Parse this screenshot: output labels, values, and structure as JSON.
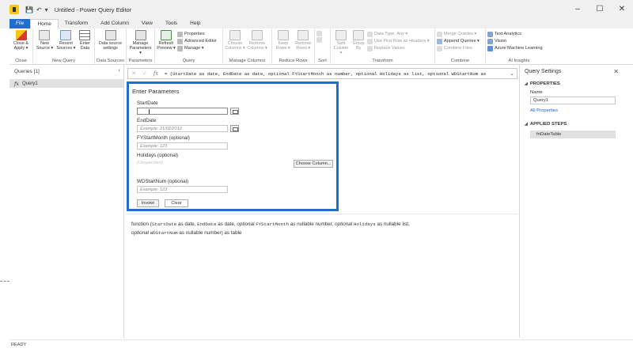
{
  "window": {
    "title": "Untitled - Power Query Editor",
    "controls": {
      "minimize": "–",
      "maximize": "☐",
      "close": "✕"
    }
  },
  "quick_access": [
    "💾",
    "↶",
    "▾"
  ],
  "tabs": [
    "File",
    "Home",
    "Transform",
    "Add Column",
    "View",
    "Tools",
    "Help"
  ],
  "ribbon": {
    "close": {
      "label": "Close",
      "close_apply": "Close & Apply ▾"
    },
    "new_query": {
      "label": "New Query",
      "new_source": "New Source ▾",
      "recent_sources": "Recent Sources ▾",
      "enter_data": "Enter Data"
    },
    "data_sources": {
      "label": "Data Sources",
      "settings": "Data source settings"
    },
    "parameters": {
      "label": "Parameters",
      "manage": "Manage Parameters ▾"
    },
    "query": {
      "label": "Query",
      "refresh": "Refresh Preview ▾",
      "properties": "Properties",
      "advanced_editor": "Advanced Editor",
      "manage": "Manage ▾"
    },
    "manage_columns": {
      "label": "Manage Columns",
      "choose": "Choose Columns ▾",
      "remove": "Remove Columns ▾"
    },
    "reduce_rows": {
      "label": "Reduce Rows",
      "keep": "Keep Rows ▾",
      "remove": "Remove Rows ▾"
    },
    "sort": {
      "label": "Sort"
    },
    "transform": {
      "label": "Transform",
      "split": "Split Column ▾",
      "group_by": "Group By",
      "data_type": "Data Type: Any ▾",
      "first_row": "Use First Row as Headers ▾",
      "replace": "Replace Values"
    },
    "combine": {
      "label": "Combine",
      "merge": "Merge Queries ▾",
      "append": "Append Queries ▾",
      "combine_files": "Combine Files"
    },
    "ai_insights": {
      "label": "AI Insights",
      "text_analytics": "Text Analytics",
      "vision": "Vision",
      "azure_ml": "Azure Machine Learning"
    }
  },
  "queries_pane": {
    "header": "Queries [1]",
    "collapse": "‹",
    "items": [
      {
        "icon": "fx",
        "name": "Query1"
      }
    ]
  },
  "formula_bar": {
    "cancel": "✕",
    "commit": "✓",
    "fx": "fx",
    "text": "= (StartDate as date, EndDate as date, optional FYStartMonth as number, optional Holidays as list, optional WDStartNum as",
    "expand": "⌄"
  },
  "enter_parameters": {
    "title": "Enter Parameters",
    "start_date": {
      "label": "StartDate",
      "value": ""
    },
    "end_date": {
      "label": "EndDate",
      "placeholder": "Example: 21/02/2012"
    },
    "fy_start_month": {
      "label": "FYStartMonth (optional)",
      "placeholder": "Example: 123"
    },
    "holidays": {
      "label": "Holidays (optional)",
      "value": "(Unspecified)",
      "choose_column": "Choose Column..."
    },
    "wd_start_num": {
      "label": "WDStartNum (optional)",
      "placeholder": "Example: 123"
    },
    "invoke": "Invoke",
    "clear": "Clear"
  },
  "function_description": {
    "p1": "function (",
    "p2": "StartDate",
    "p3": " as date, ",
    "p4": "EndDate",
    "p5": " as date, ",
    "p6": "optional",
    "p7": " ",
    "p8": "FYStartMonth",
    "p9": " as nullable number, ",
    "p10": "optional",
    "p11": " ",
    "p12": "Holidays",
    "p13": " as nullable list,",
    "p14": "optional",
    "p15": " ",
    "p16": "WDStartNum",
    "p17": " as nullable number) as table"
  },
  "query_settings": {
    "title": "Query Settings",
    "close": "✕",
    "properties_header": "PROPERTIES",
    "name_label": "Name",
    "name_value": "Query1",
    "all_properties": "All Properties",
    "applied_steps_header": "APPLIED STEPS",
    "steps": [
      "fnDateTable"
    ]
  },
  "status": "READY",
  "colors": {
    "accent": "#1f6fce",
    "highlight_border": "#1f6fce"
  }
}
